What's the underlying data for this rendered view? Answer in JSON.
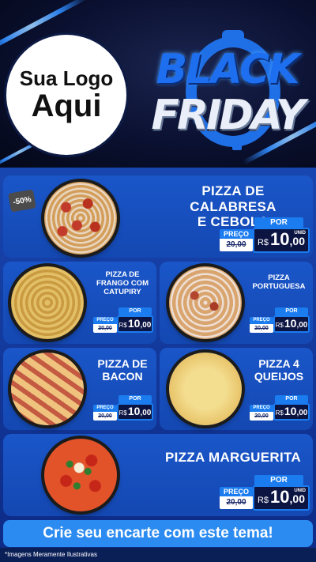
{
  "header": {
    "logo_line1": "Sua Logo",
    "logo_line2": "Aqui",
    "black": "BLACK",
    "friday": "FRIDAY"
  },
  "colors": {
    "accent": "#1b7cf0",
    "background": "#0b1f57",
    "card": "#1a56c9"
  },
  "price_labels": {
    "preco": "PREÇO",
    "por": "POR",
    "rs": "R$",
    "unid": "UNID"
  },
  "items": [
    {
      "name_line1": "PIZZA DE CALABRESA",
      "name_line2": "E CEBOLA",
      "old_price": "20,00",
      "new_int": "10",
      "new_dec": ",00",
      "badge": "-50%"
    },
    {
      "name_line1": "PIZZA DE",
      "name_line2": "FRANGO COM",
      "name_line3": "CATUPIRY",
      "old_price": "20,00",
      "new_int": "10",
      "new_dec": ",00"
    },
    {
      "name_line1": "PIZZA",
      "name_line2": "PORTUGUESA",
      "old_price": "20,00",
      "new_int": "10",
      "new_dec": ",00"
    },
    {
      "name_line1": "PIZZA DE",
      "name_line2": "BACON",
      "old_price": "20,00",
      "new_int": "10",
      "new_dec": ",00"
    },
    {
      "name_line1": "PIZZA 4",
      "name_line2": "QUEIJOS",
      "old_price": "20,00",
      "new_int": "10",
      "new_dec": ",00"
    },
    {
      "name_line1": "PIZZA MARGUERITA",
      "old_price": "20,00",
      "new_int": "10",
      "new_dec": ",00"
    }
  ],
  "cta": "Crie seu encarte com este tema!",
  "footnote": "*Imagens Meramente Ilustrativas"
}
